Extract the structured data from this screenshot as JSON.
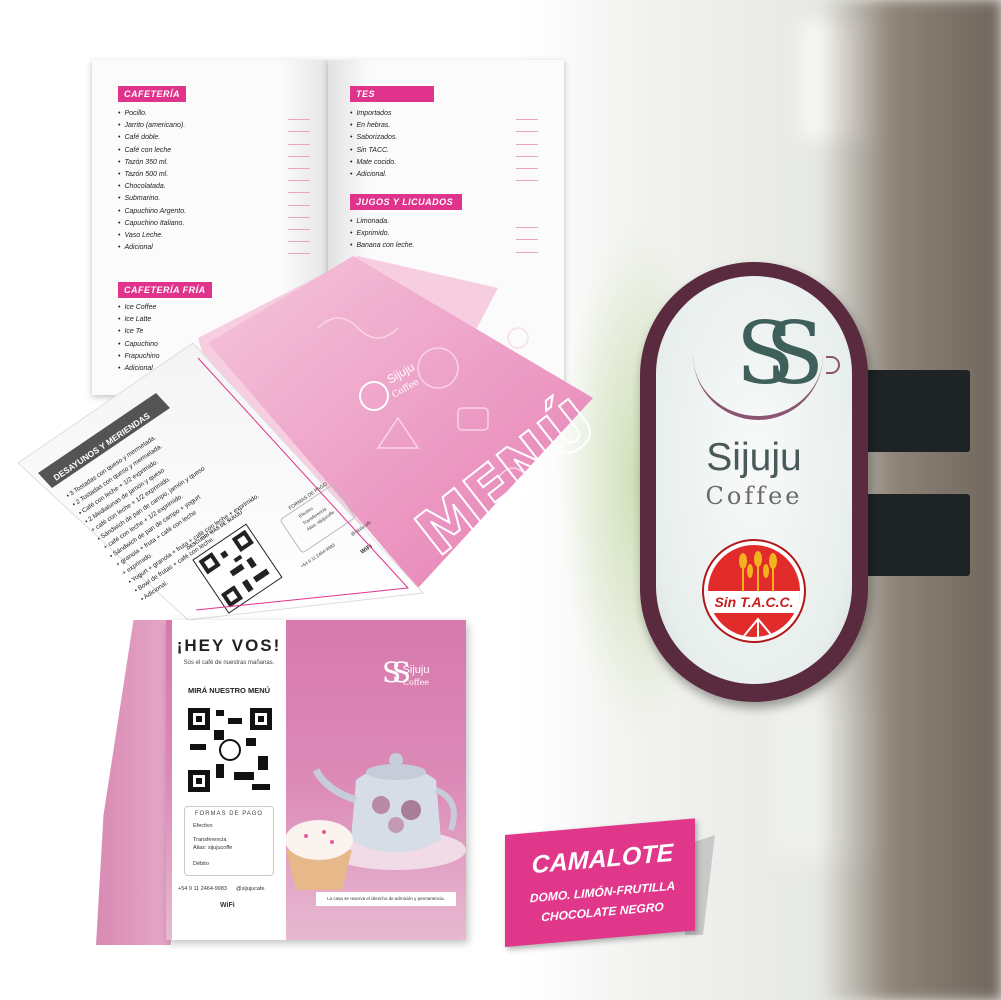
{
  "colors": {
    "brand_pink": "#e0338c",
    "sign_frame": "#5a2a3e",
    "teal_logo": "#3f5f5b",
    "tacc_red": "#e22b2b"
  },
  "sign": {
    "logo_letters": "SS",
    "name": "Sijuju",
    "sub": "Coffee",
    "badge": "Sin T.A.C.C."
  },
  "booklet": {
    "cafeteria": {
      "title": "CAFETERÍA",
      "items": [
        "Pocillo.",
        "Jarrito (americano).",
        "Café doble.",
        "Café con leche",
        "Tazón 350 ml.",
        "Tazón 500 ml.",
        "Chocolatada.",
        "Submarino.",
        "Capuchino Argento.",
        "Capuchino Italiano.",
        "Vaso Leche.",
        "Adicional"
      ]
    },
    "cafeteria_fria": {
      "title": "CAFETERÍA FRÍA",
      "items": [
        "Ice Coffee",
        "Ice Latte",
        "Ice Te",
        "Capuchino",
        "Frapuchino",
        "Adicional"
      ]
    },
    "tes": {
      "title": "TES",
      "items": [
        "Importados",
        "En hebras.",
        "Saborizados.",
        "Sin TACC.",
        "Mate cocido.",
        "Adicional."
      ]
    },
    "jugos": {
      "title": "JUGOS Y LICUADOS",
      "items": [
        "Limonada.",
        "Exprimido.",
        "Banana con leche."
      ]
    }
  },
  "folded_menu": {
    "brand_name": "Sijuju",
    "brand_sub": "Coffee",
    "cover_word": "MENÚ",
    "section_title": "DESAYUNOS Y MERIENDAS",
    "items": [
      "3 Tostadas con queso y mermelada.",
      "2 Tostadas con queso y mermelada.",
      "Café con leche + 1/2 exprimido.",
      "2 Medialunas de jamón y queso",
      "+ café con leche + 1/2 exprimido.",
      "Sándwich de pan de campo, jamón y queso",
      "+ café con leche + 1/2 exprimido.",
      "Sándwich de pan de campo + yogurt",
      "+ granola + fruta + café con leche",
      "+ exprimido.",
      "Yogurt + granola + fruta + café con leche + exprimido.",
      "Bowl de frutas + café con leche.",
      "Adicional."
    ],
    "qr_caption": "DESCUBRÍ MÁS DE SIJUJU",
    "pay_title": "FORMAS DE PAGO",
    "pay_items": [
      "Efectivo",
      "Transferencia",
      "Alias: sijujucoffe"
    ],
    "phone": "+54 9 11 2464-9983",
    "instagram": "@sijujucafe",
    "wifi": "WiFi"
  },
  "tent": {
    "hey": "¡HEY VOS!",
    "subtitle": "Sos el café de nuestras mañanas.",
    "look": "MIRÁ NUESTRO MENÚ",
    "pay_title": "FORMAS DE PAGO",
    "pay_items": [
      "Efectivo",
      "Transferencia",
      "Alias: sijujucoffe",
      "Débito"
    ],
    "phone": "+54 9 11 2464-9983",
    "instagram": "@sijujucafe",
    "wifi": "WiFi",
    "brand_name": "Sijuju",
    "brand_sub": "Coffee",
    "legal": "La casa se reserva el derecho de admisión y permanencia."
  },
  "name_card": {
    "title": "CAMALOTE",
    "line1": "DOMO. LIMÓN-FRUTILLA",
    "line2": "CHOCOLATE NEGRO"
  }
}
